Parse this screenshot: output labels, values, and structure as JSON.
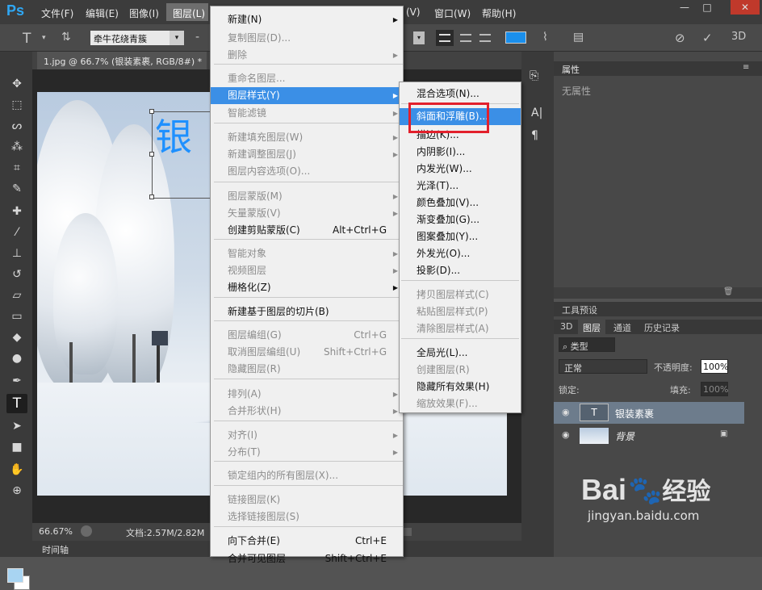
{
  "menubar": {
    "logo": "Ps",
    "items": [
      "文件(F)",
      "编辑(E)",
      "图像(I)",
      "图层(L)",
      "(V)",
      "窗口(W)",
      "帮助(H)"
    ]
  },
  "window_controls": [
    "—",
    "□",
    "✕"
  ],
  "options": {
    "font": "牵牛花绕青簇",
    "minus": "-"
  },
  "document": {
    "tab": "1.jpg @ 66.7% (银装素裹, RGB/8#) *",
    "tab_close": "×",
    "canvas_text": "银",
    "zoom": "66.67%",
    "doc_info": "文档:2.57M/2.82M",
    "timeline": "时间轴"
  },
  "menu_layer": {
    "items": [
      {
        "label": "新建(N)",
        "shortcut": "",
        "sub": true,
        "disabled": false
      },
      {
        "label": "复制图层(D)...",
        "shortcut": "",
        "sub": false,
        "disabled": true
      },
      {
        "label": "删除",
        "shortcut": "",
        "sub": true,
        "disabled": true
      },
      {
        "label": "重命名图层...",
        "shortcut": "",
        "sub": false,
        "disabled": true
      },
      {
        "label": "图层样式(Y)",
        "shortcut": "",
        "sub": true,
        "disabled": false,
        "highlight": true
      },
      {
        "label": "智能滤镜",
        "shortcut": "",
        "sub": true,
        "disabled": true
      },
      {
        "label": "新建填充图层(W)",
        "shortcut": "",
        "sub": true,
        "disabled": true
      },
      {
        "label": "新建调整图层(J)",
        "shortcut": "",
        "sub": true,
        "disabled": true
      },
      {
        "label": "图层内容选项(O)...",
        "shortcut": "",
        "sub": false,
        "disabled": true
      },
      {
        "label": "图层蒙版(M)",
        "shortcut": "",
        "sub": true,
        "disabled": true
      },
      {
        "label": "矢量蒙版(V)",
        "shortcut": "",
        "sub": true,
        "disabled": true
      },
      {
        "label": "创建剪贴蒙版(C)",
        "shortcut": "Alt+Ctrl+G",
        "sub": false,
        "disabled": false
      },
      {
        "label": "智能对象",
        "shortcut": "",
        "sub": true,
        "disabled": true
      },
      {
        "label": "视频图层",
        "shortcut": "",
        "sub": true,
        "disabled": true
      },
      {
        "label": "栅格化(Z)",
        "shortcut": "",
        "sub": true,
        "disabled": false
      },
      {
        "label": "新建基于图层的切片(B)",
        "shortcut": "",
        "sub": false,
        "disabled": false
      },
      {
        "label": "图层编组(G)",
        "shortcut": "Ctrl+G",
        "sub": false,
        "disabled": true
      },
      {
        "label": "取消图层编组(U)",
        "shortcut": "Shift+Ctrl+G",
        "sub": false,
        "disabled": true
      },
      {
        "label": "隐藏图层(R)",
        "shortcut": "",
        "sub": false,
        "disabled": true
      },
      {
        "label": "排列(A)",
        "shortcut": "",
        "sub": true,
        "disabled": true
      },
      {
        "label": "合并形状(H)",
        "shortcut": "",
        "sub": true,
        "disabled": true
      },
      {
        "label": "对齐(I)",
        "shortcut": "",
        "sub": true,
        "disabled": true
      },
      {
        "label": "分布(T)",
        "shortcut": "",
        "sub": true,
        "disabled": true
      },
      {
        "label": "锁定组内的所有图层(X)...",
        "shortcut": "",
        "sub": false,
        "disabled": true
      },
      {
        "label": "链接图层(K)",
        "shortcut": "",
        "sub": false,
        "disabled": true
      },
      {
        "label": "选择链接图层(S)",
        "shortcut": "",
        "sub": false,
        "disabled": true
      },
      {
        "label": "向下合并(E)",
        "shortcut": "Ctrl+E",
        "sub": false,
        "disabled": false
      },
      {
        "label": "合并可见图层",
        "shortcut": "Shift+Ctrl+E",
        "sub": false,
        "disabled": false
      }
    ]
  },
  "menu_style": {
    "items": [
      {
        "label": "混合选项(N)...",
        "disabled": false
      },
      {
        "label": "斜面和浮雕(B)...",
        "disabled": false,
        "highlight": true
      },
      {
        "label": "描边(K)...",
        "disabled": false
      },
      {
        "label": "内阴影(I)...",
        "disabled": false
      },
      {
        "label": "内发光(W)...",
        "disabled": false
      },
      {
        "label": "光泽(T)...",
        "disabled": false
      },
      {
        "label": "颜色叠加(V)...",
        "disabled": false
      },
      {
        "label": "渐变叠加(G)...",
        "disabled": false
      },
      {
        "label": "图案叠加(Y)...",
        "disabled": false
      },
      {
        "label": "外发光(O)...",
        "disabled": false
      },
      {
        "label": "投影(D)...",
        "disabled": false
      },
      {
        "label": "拷贝图层样式(C)",
        "disabled": true
      },
      {
        "label": "粘贴图层样式(P)",
        "disabled": true
      },
      {
        "label": "清除图层样式(A)",
        "disabled": true
      },
      {
        "label": "全局光(L)...",
        "disabled": false
      },
      {
        "label": "创建图层(R)",
        "disabled": true
      },
      {
        "label": "隐藏所有效果(H)",
        "disabled": false
      },
      {
        "label": "缩放效果(F)...",
        "disabled": true
      }
    ]
  },
  "properties": {
    "title": "属性",
    "empty": "无属性"
  },
  "panels": {
    "tool_presets": "工具预设",
    "tabs": [
      "3D",
      "图层",
      "通道",
      "历史记录"
    ],
    "filter": "类型",
    "blend_mode": "正常",
    "opacity_label": "不透明度:",
    "opacity": "100%",
    "lock_label": "锁定:",
    "fill_label": "填充:",
    "fill": "100%",
    "layers": [
      {
        "name": "银装素裹",
        "type": "text",
        "thumb": "T"
      },
      {
        "name": "背景",
        "type": "image"
      }
    ]
  },
  "watermark": {
    "brand": "Bai",
    "brand2": "经验",
    "url": "jingyan.baidu.com"
  },
  "colors": {
    "accent": "#3b8fe6",
    "text_color": "#1e90ff",
    "callout": "#e2202c"
  }
}
